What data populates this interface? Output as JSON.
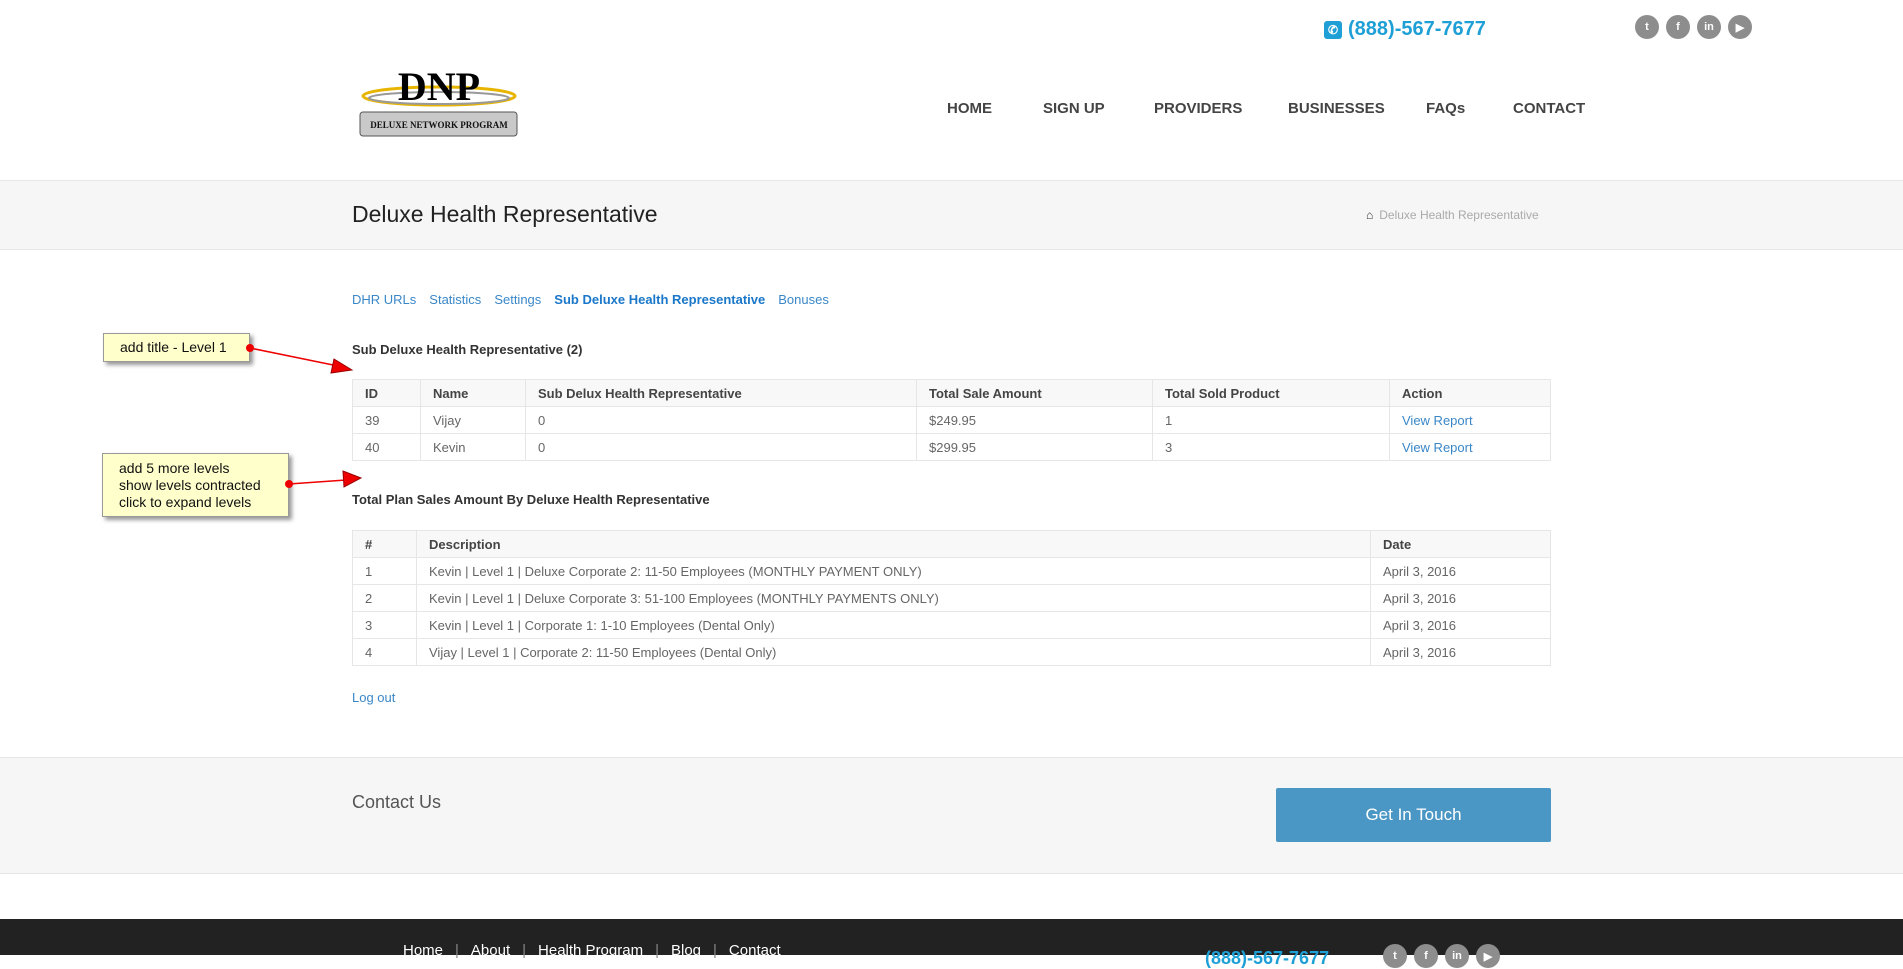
{
  "header": {
    "phone": "(888)-567-7677",
    "social": [
      "twitter",
      "facebook",
      "linkedin",
      "youtube"
    ],
    "logo_text": "DNP",
    "logo_sub": "DELUXE NETWORK PROGRAM",
    "nav": [
      "HOME",
      "SIGN UP",
      "PROVIDERS",
      "BUSINESSES",
      "FAQs",
      "CONTACT"
    ]
  },
  "page": {
    "title": "Deluxe Health Representative",
    "breadcrumb": "Deluxe Health Representative"
  },
  "tabs": [
    "DHR URLs",
    "Statistics",
    "Settings",
    "Sub Deluxe Health Representative",
    "Bonuses"
  ],
  "sub_table": {
    "title": "Sub Deluxe Health Representative (2)",
    "headers": [
      "ID",
      "Name",
      "Sub Delux Health Representative",
      "Total Sale Amount",
      "Total Sold Product",
      "Action"
    ],
    "rows": [
      [
        "39",
        "Vijay",
        "0",
        "$249.95",
        "1",
        "View Report"
      ],
      [
        "40",
        "Kevin",
        "0",
        "$299.95",
        "3",
        "View Report"
      ]
    ]
  },
  "sales_table": {
    "title": "Total Plan Sales Amount By Deluxe Health Representative",
    "headers": [
      "#",
      "Description",
      "Date"
    ],
    "rows": [
      [
        "1",
        "Kevin | Level 1 | Deluxe Corporate 2: 11-50 Employees (MONTHLY PAYMENT ONLY)",
        "April 3, 2016"
      ],
      [
        "2",
        "Kevin | Level 1 | Deluxe Corporate 3: 51-100 Employees (MONTHLY PAYMENTS ONLY)",
        "April 3, 2016"
      ],
      [
        "3",
        "Kevin | Level 1 | Corporate 1: 1-10 Employees (Dental Only)",
        "April 3, 2016"
      ],
      [
        "4",
        "Vijay | Level 1 | Corporate 2: 11-50 Employees (Dental Only)",
        "April 3, 2016"
      ]
    ]
  },
  "logout": "Log out",
  "contact": {
    "title": "Contact Us",
    "button": "Get In Touch"
  },
  "footer": {
    "links": [
      "Home",
      "About",
      "Health Program",
      "Blog",
      "Contact"
    ],
    "sep": "|"
  },
  "annotations": {
    "note1": "add title - Level 1",
    "note2": [
      "add 5 more levels",
      "show levels contracted",
      "click to expand levels"
    ]
  },
  "colors": {
    "accent": "#1ea0d6",
    "link": "#3a87c8",
    "button": "#4a96c4",
    "note": "#ffffcc",
    "arrow": "#e00000"
  }
}
